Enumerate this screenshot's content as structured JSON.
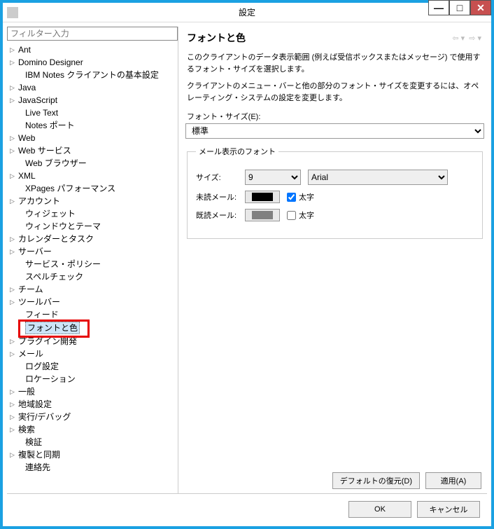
{
  "window": {
    "title": "設定",
    "minimize": "—",
    "maximize": "□",
    "close": "✕"
  },
  "filter": {
    "placeholder": "フィルター入力"
  },
  "tree": [
    {
      "label": "Ant",
      "expand": true
    },
    {
      "label": "Domino Designer",
      "expand": true
    },
    {
      "label": "IBM Notes クライアントの基本設定",
      "expand": false,
      "child": true
    },
    {
      "label": "Java",
      "expand": true
    },
    {
      "label": "JavaScript",
      "expand": true
    },
    {
      "label": "Live Text",
      "expand": false,
      "child": true
    },
    {
      "label": "Notes ポート",
      "expand": false,
      "child": true
    },
    {
      "label": "Web",
      "expand": true
    },
    {
      "label": "Web サービス",
      "expand": true
    },
    {
      "label": "Web ブラウザー",
      "expand": false,
      "child": true
    },
    {
      "label": "XML",
      "expand": true
    },
    {
      "label": "XPages パフォーマンス",
      "expand": false,
      "child": true
    },
    {
      "label": "アカウント",
      "expand": true
    },
    {
      "label": "ウィジェット",
      "expand": false,
      "child": true
    },
    {
      "label": "ウィンドウとテーマ",
      "expand": false,
      "child": true
    },
    {
      "label": "カレンダーとタスク",
      "expand": true
    },
    {
      "label": "サーバー",
      "expand": true
    },
    {
      "label": "サービス・ポリシー",
      "expand": false,
      "child": true
    },
    {
      "label": "スペルチェック",
      "expand": false,
      "child": true
    },
    {
      "label": "チーム",
      "expand": true
    },
    {
      "label": "ツールバー",
      "expand": true
    },
    {
      "label": "フィード",
      "expand": false,
      "child": true
    },
    {
      "label": "フォントと色",
      "expand": false,
      "child": true,
      "selected": true,
      "highlighted": true
    },
    {
      "label": "プラグイン開発",
      "expand": true
    },
    {
      "label": "メール",
      "expand": true
    },
    {
      "label": "ログ設定",
      "expand": false,
      "child": true
    },
    {
      "label": "ロケーション",
      "expand": false,
      "child": true
    },
    {
      "label": "一般",
      "expand": true
    },
    {
      "label": "地域設定",
      "expand": true
    },
    {
      "label": "実行/デバッグ",
      "expand": true
    },
    {
      "label": "検索",
      "expand": true
    },
    {
      "label": "検証",
      "expand": false,
      "child": true
    },
    {
      "label": "複製と同期",
      "expand": true
    },
    {
      "label": "連絡先",
      "expand": false,
      "child": true
    }
  ],
  "page": {
    "title": "フォントと色",
    "back": "⇦ ▾",
    "fwd": "⇨ ▾",
    "desc1": "このクライアントのデータ表示範囲 (例えば受信ボックスまたはメッセージ) で使用するフォント・サイズを選択します。",
    "desc2": "クライアントのメニュー・バーと他の部分のフォント・サイズを変更するには、オペレーティング・システムの設定を変更します。",
    "fontsize_label": "フォント・サイズ(E):",
    "fontsize_value": "標準",
    "groupbox": "メール表示のフォント",
    "size_label": "サイズ:",
    "size_value": "9",
    "font_value": "Arial",
    "unread_label": "未読メール:",
    "unread_color": "#000000",
    "unread_bold": "太字",
    "unread_bold_checked": true,
    "read_label": "既読メール:",
    "read_color": "#808080",
    "read_bold": "太字",
    "read_bold_checked": false
  },
  "buttons": {
    "restore": "デフォルトの復元(D)",
    "apply": "適用(A)",
    "ok": "OK",
    "cancel": "キャンセル"
  }
}
